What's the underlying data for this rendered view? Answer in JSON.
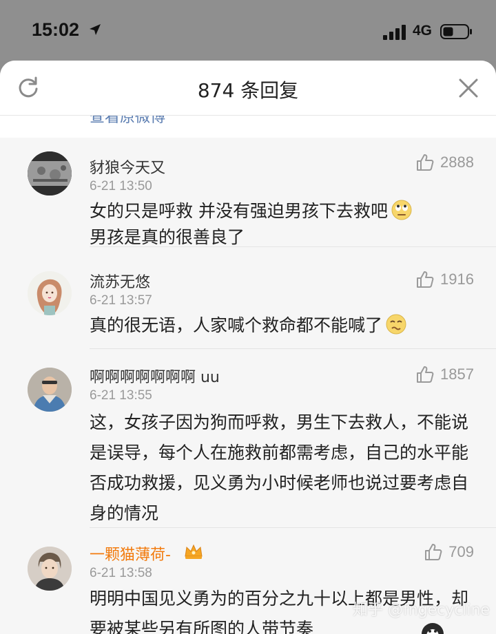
{
  "status_bar": {
    "time": "15:02",
    "network": "4G"
  },
  "header": {
    "title": "874 条回复"
  },
  "peek": {
    "text": "查看原微博"
  },
  "comments": [
    {
      "name": "豺狼今天又",
      "date": "6-21 13:50",
      "likes": "2888",
      "content": "女的只是呼救 并没有强迫男孩下去救吧",
      "content2": "男孩是真的很善良了",
      "emoji": "eye-roll-emoji"
    },
    {
      "name": "流苏无悠",
      "date": "6-21 13:57",
      "likes": "1916",
      "content": "真的很无语，人家喊个救命都不能喊了",
      "emoji": "speechless-emoji"
    },
    {
      "name": "啊啊啊啊啊啊啊 uu",
      "date": "6-21 13:55",
      "likes": "1857",
      "content": "这，女孩子因为狗而呼救，男生下去救人，不能说是误导，每个人在施救前都需考虑，自己的水平能否成功救援，见义勇为小时候老师也说过要考虑自身的情况"
    },
    {
      "name": "一颗猫薄荷-",
      "date": "6-21 13:58",
      "likes": "709",
      "content": "明明中国见义勇为的百分之九十以上都是男性，却要被某些另有所图的人带节奏",
      "vip": true
    }
  ],
  "watermark": "知乎 @fngecycline",
  "colors": {
    "vip_name": "#f27b0e",
    "sheet_bg": "#f6f6f6",
    "statusbar_bg": "#8f8f8f"
  }
}
